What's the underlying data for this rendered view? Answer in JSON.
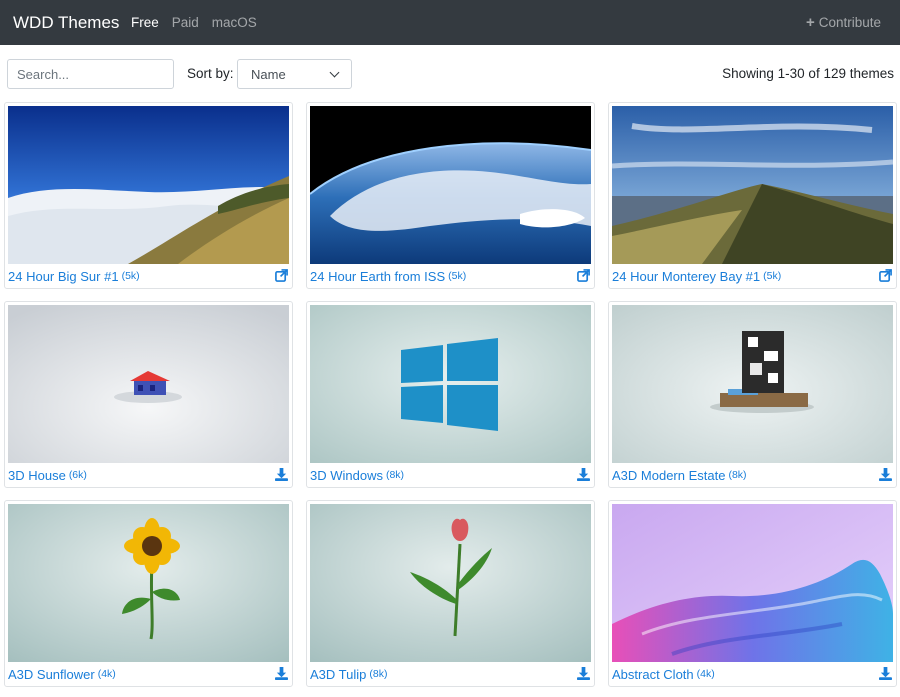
{
  "navbar": {
    "brand": "WDD Themes",
    "links": [
      {
        "label": "Free",
        "active": true
      },
      {
        "label": "Paid",
        "active": false
      },
      {
        "label": "macOS",
        "active": false
      }
    ],
    "contribute_label": "Contribute",
    "contribute_icon": "plus-icon"
  },
  "toolbar": {
    "search_placeholder": "Search...",
    "sort_label": "Sort by:",
    "sort_value": "Name",
    "showing": "Showing 1-30 of 129 themes"
  },
  "colors": {
    "navbar_bg": "#343a40",
    "link": "#1a7ed9",
    "card_border": "#dfe2e5"
  },
  "themes": [
    {
      "title": "24 Hour Big Sur #1",
      "size": "(5k)",
      "action_icon": "external-link-icon"
    },
    {
      "title": "24 Hour Earth from ISS",
      "size": "(5k)",
      "action_icon": "external-link-icon"
    },
    {
      "title": "24 Hour Monterey Bay #1",
      "size": "(5k)",
      "action_icon": "external-link-icon"
    },
    {
      "title": "3D House",
      "size": "(6k)",
      "action_icon": "download-icon"
    },
    {
      "title": "3D Windows",
      "size": "(8k)",
      "action_icon": "download-icon"
    },
    {
      "title": "A3D Modern Estate",
      "size": "(8k)",
      "action_icon": "download-icon"
    },
    {
      "title": "A3D Sunflower",
      "size": "(4k)",
      "action_icon": "download-icon"
    },
    {
      "title": "A3D Tulip",
      "size": "(8k)",
      "action_icon": "download-icon"
    },
    {
      "title": "Abstract Cloth",
      "size": "(4k)",
      "action_icon": "download-icon"
    }
  ]
}
